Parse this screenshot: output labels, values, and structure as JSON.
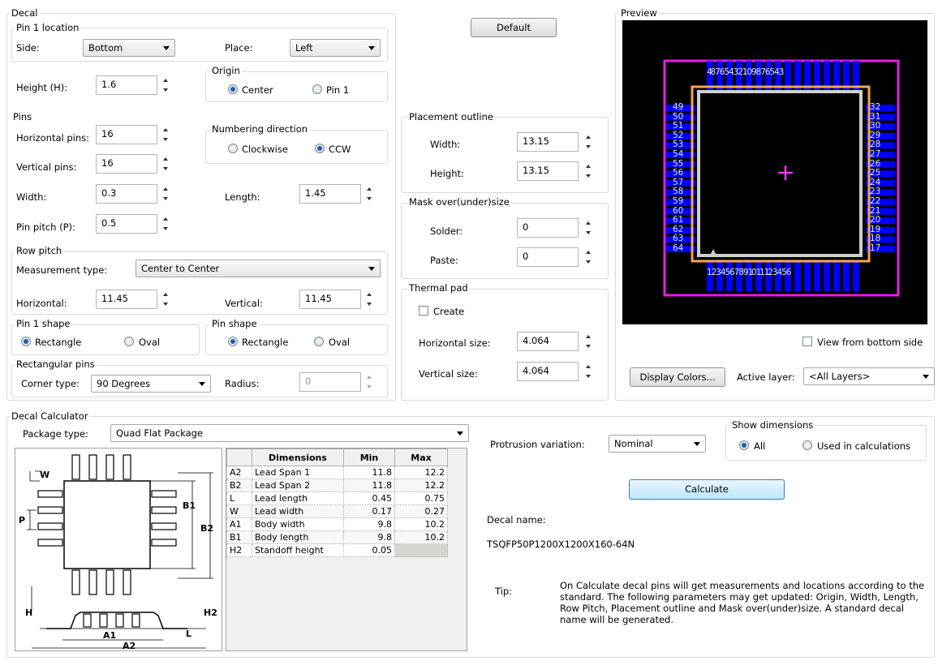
{
  "decal": {
    "title": "Decal",
    "pin1_location": {
      "title": "Pin 1 location",
      "side_label": "Side:",
      "side_value": "Bottom",
      "place_label": "Place:",
      "place_value": "Left",
      "height_label": "Height (H):",
      "height_value": "1.6"
    },
    "origin": {
      "title": "Origin",
      "center_label": "Center",
      "pin1_label": "Pin 1",
      "selected": "Center"
    },
    "pins": {
      "title": "Pins",
      "horizontal_label": "Horizontal pins:",
      "horizontal_value": "16",
      "vertical_label": "Vertical pins:",
      "vertical_value": "16",
      "width_label": "Width:",
      "width_value": "0.3",
      "length_label": "Length:",
      "length_value": "1.45",
      "pitch_label": "Pin pitch (P):",
      "pitch_value": "0.5"
    },
    "numbering": {
      "title": "Numbering direction",
      "clockwise_label": "Clockwise",
      "ccw_label": "CCW",
      "selected": "CCW"
    },
    "row_pitch": {
      "title": "Row pitch",
      "measurement_label": "Measurement type:",
      "measurement_value": "Center to Center",
      "horizontal_label": "Horizontal:",
      "horizontal_value": "11.45",
      "vertical_label": "Vertical:",
      "vertical_value": "11.45"
    },
    "pin1_shape": {
      "title": "Pin 1 shape",
      "rectangle_label": "Rectangle",
      "oval_label": "Oval",
      "selected": "Rectangle"
    },
    "pin_shape": {
      "title": "Pin shape",
      "rectangle_label": "Rectangle",
      "oval_label": "Oval",
      "selected": "Rectangle"
    },
    "rect_pins": {
      "title": "Rectangular pins",
      "corner_label": "Corner type:",
      "corner_value": "90 Degrees",
      "radius_label": "Radius:",
      "radius_value": "0"
    }
  },
  "default_button": "Default",
  "placement_outline": {
    "title": "Placement outline",
    "width_label": "Width:",
    "width_value": "13.15",
    "height_label": "Height:",
    "height_value": "13.15"
  },
  "mask": {
    "title": "Mask over(under)size",
    "solder_label": "Solder:",
    "solder_value": "0",
    "paste_label": "Paste:",
    "paste_value": "0"
  },
  "thermal_pad": {
    "title": "Thermal pad",
    "create_label": "Create",
    "create_checked": false,
    "hsize_label": "Horizontal size:",
    "hsize_value": "4.064",
    "vsize_label": "Vertical size:",
    "vsize_value": "4.064"
  },
  "preview": {
    "title": "Preview",
    "top_numbers": "48 7 6 5 4 3 2 1 0 9 8 7 6 5 4 3",
    "bottom_numbers": "1 2 3 4 5 6 7 8 9 10 11 12 3 4 5 6",
    "left_numbers": [
      "49",
      "50",
      "51",
      "52",
      "53",
      "54",
      "55",
      "56",
      "57",
      "58",
      "59",
      "60",
      "61",
      "62",
      "63",
      "64"
    ],
    "right_numbers": [
      "32",
      "31",
      "30",
      "29",
      "28",
      "27",
      "26",
      "25",
      "24",
      "23",
      "22",
      "21",
      "20",
      "19",
      "18",
      "17"
    ],
    "view_bottom_label": "View from bottom side",
    "view_bottom_checked": false,
    "display_colors_button": "Display Colors...",
    "active_layer_label": "Active layer:",
    "active_layer_value": "<All Layers>",
    "colors": {
      "background": "#000000",
      "pad": "#0000ff",
      "outline": "#e61ee6",
      "body": "#f5a64b",
      "silk": "#cfcfcf",
      "origin": "#ff00ff"
    }
  },
  "calculator": {
    "title": "Decal Calculator",
    "package_label": "Package type:",
    "package_value": "Quad Flat Package",
    "diagram_labels": {
      "W": "W",
      "P": "P",
      "B1": "B1",
      "B2": "B2",
      "H": "H",
      "H2": "H2",
      "A1": "A1",
      "A2": "A2",
      "L": "L"
    },
    "table": {
      "headers": [
        "",
        "Dimensions",
        "Min",
        "Max"
      ],
      "rows": [
        {
          "code": "A2",
          "name": "Lead Span 1",
          "min": "11.8",
          "max": "12.2"
        },
        {
          "code": "B2",
          "name": "Lead Span 2",
          "min": "11.8",
          "max": "12.2"
        },
        {
          "code": "L",
          "name": "Lead length",
          "min": "0.45",
          "max": "0.75"
        },
        {
          "code": "W",
          "name": "Lead width",
          "min": "0.17",
          "max": "0.27"
        },
        {
          "code": "A1",
          "name": "Body width",
          "min": "9.8",
          "max": "10.2"
        },
        {
          "code": "B1",
          "name": "Body length",
          "min": "9.8",
          "max": "10.2"
        },
        {
          "code": "H2",
          "name": "Standoff height",
          "min": "0.05",
          "max": ""
        }
      ]
    },
    "protrusion_label": "Protrusion variation:",
    "protrusion_value": "Nominal",
    "show_dimensions": {
      "title": "Show dimensions",
      "all_label": "All",
      "used_label": "Used in calculations",
      "selected": "All"
    },
    "calculate_button": "Calculate",
    "decal_name_label": "Decal name:",
    "decal_name_value": "TSQFP50P1200X1200X160-64N",
    "tip_label": "Tip:",
    "tip_text": "On Calculate decal pins will get measurements and locations according to the standard. The following parameters may get updated: Origin, Width, Length, Row Pitch, Placement outline and Mask over(under)size. A standard decal name will be generated."
  }
}
